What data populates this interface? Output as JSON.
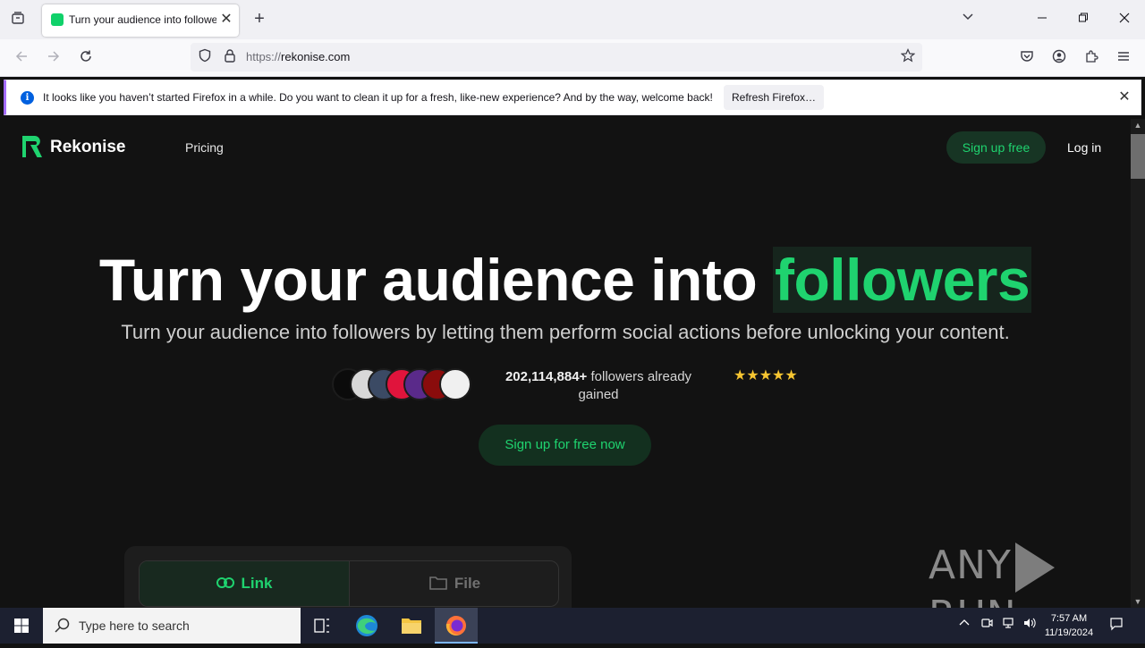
{
  "browser": {
    "tab_title": "Turn your audience into followers",
    "tab_close": "✕",
    "new_tab": "+",
    "url_protocol": "https://",
    "url_host": "rekonise.com"
  },
  "notification": {
    "message": "It looks like you haven’t started Firefox in a while. Do you want to clean it up for a fresh, like-new experience? And by the way, welcome back!",
    "button": "Refresh Firefox…",
    "close": "✕"
  },
  "site": {
    "brand": "Rekonise",
    "nav_pricing": "Pricing",
    "signup": "Sign up free",
    "login": "Log in"
  },
  "hero": {
    "headline_main": "Turn your audience into ",
    "headline_accent": "followers",
    "subline": "Turn your audience into followers by letting them perform social actions before unlocking your content.",
    "followers_count": "202,114,884+",
    "followers_text": " followers already gained",
    "rating_stars": "★★★★★",
    "cta": "Sign up for free now"
  },
  "upload": {
    "tab_link": "Link",
    "tab_file": "File"
  },
  "watermark": {
    "left": "ANY",
    "right": "RUN"
  },
  "taskbar": {
    "search_placeholder": "Type here to search",
    "time": "7:57 AM",
    "date": "11/19/2024"
  },
  "colors": {
    "accent": "#1fd36f",
    "page_bg": "#121212",
    "star": "#f7c531"
  }
}
